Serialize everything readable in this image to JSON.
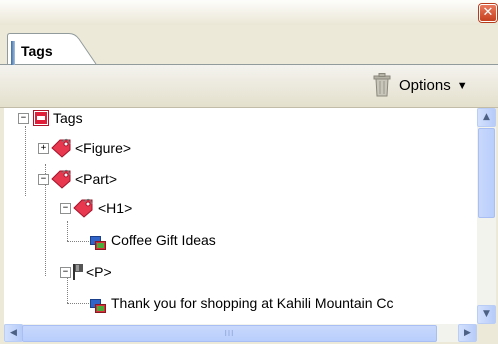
{
  "window": {
    "close_symbol": "✕"
  },
  "tabs": [
    {
      "label": "Tags",
      "active": true
    }
  ],
  "toolbar": {
    "trash_icon": "trash-icon",
    "options_label": "Options",
    "options_arrow": "▼"
  },
  "tree": {
    "expander_collapsed": "+",
    "expander_expanded": "−",
    "nodes": [
      {
        "label": "Tags",
        "icon": "tags-root-icon"
      },
      {
        "label": "<Figure>",
        "icon": "tag-icon"
      },
      {
        "label": "<Part>",
        "icon": "tag-icon"
      },
      {
        "label": "<H1>",
        "icon": "tag-icon"
      },
      {
        "label": "Coffee Gift Ideas",
        "icon": "content-icon"
      },
      {
        "label": "<P>",
        "icon": "paragraph-flag-icon"
      },
      {
        "label": "Thank you for shopping at Kahili Mountain Cc",
        "icon": "content-icon"
      }
    ]
  },
  "scrollbars": {
    "up": "▲",
    "down": "▼",
    "left": "◀",
    "right": "▶",
    "grip": "III"
  },
  "colors": {
    "tag_red": "#e0203a",
    "content_blue": "#3164c8",
    "xp_blue": "#b8cefc"
  }
}
